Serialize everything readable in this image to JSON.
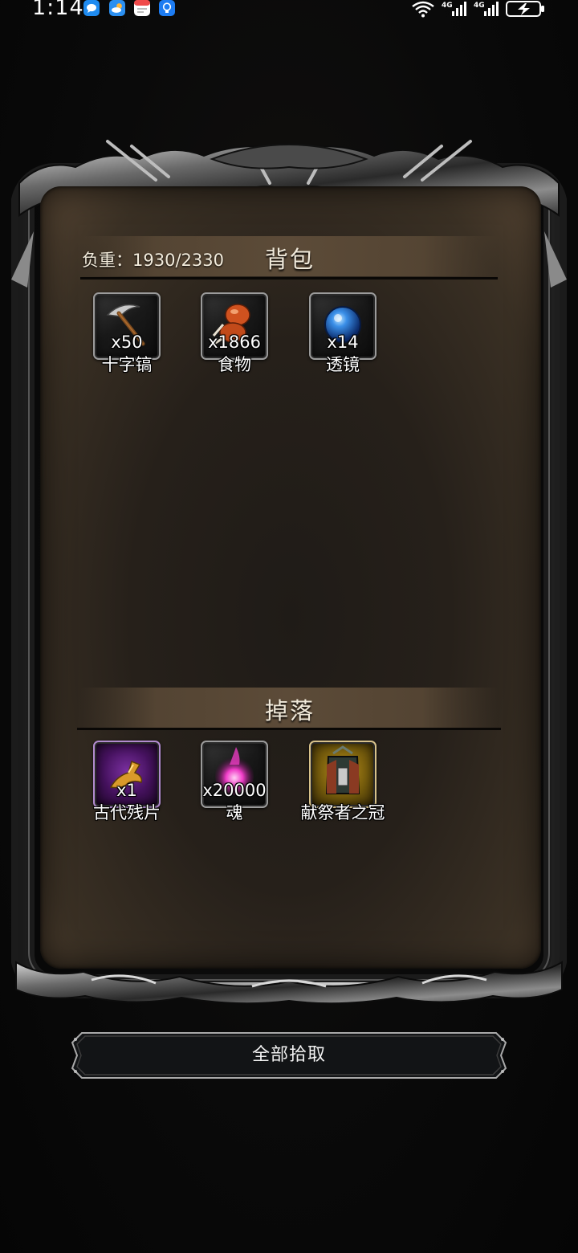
{
  "status_bar": {
    "time": "1:14",
    "notification_icons": [
      "messages-icon",
      "weather-icon",
      "calendar-icon",
      "tips-icon"
    ],
    "system_icons": [
      "wifi-icon",
      "signal-4g-icon",
      "signal-4g-icon",
      "battery-charging-icon"
    ],
    "network_labels": [
      "4G",
      "4G"
    ]
  },
  "inventory": {
    "weight_label": "负重：1930/2330",
    "title": "背包",
    "items": [
      {
        "count": "x50",
        "name": "十字镐",
        "icon": "pickaxe-icon"
      },
      {
        "count": "x1866",
        "name": "食物",
        "icon": "food-icon"
      },
      {
        "count": "x14",
        "name": "透镜",
        "icon": "lens-icon"
      }
    ]
  },
  "drops": {
    "title": "掉落",
    "items": [
      {
        "count": "x1",
        "name": "古代残片",
        "icon": "ancient-fragment-icon",
        "rarity_color": "#6a1f8c"
      },
      {
        "count": "x20000",
        "name": "魂",
        "icon": "soul-icon"
      },
      {
        "count": "",
        "name": "献祭者之冠",
        "icon": "sacrificer-crown-icon",
        "rarity_color": "#a07d12"
      }
    ]
  },
  "actions": {
    "pickup_all_label": "全部拾取"
  },
  "colors": {
    "background": "#0b0b0b",
    "parchment": "#26201a",
    "header_band": "#5c4b38",
    "text": "#ffffff"
  }
}
